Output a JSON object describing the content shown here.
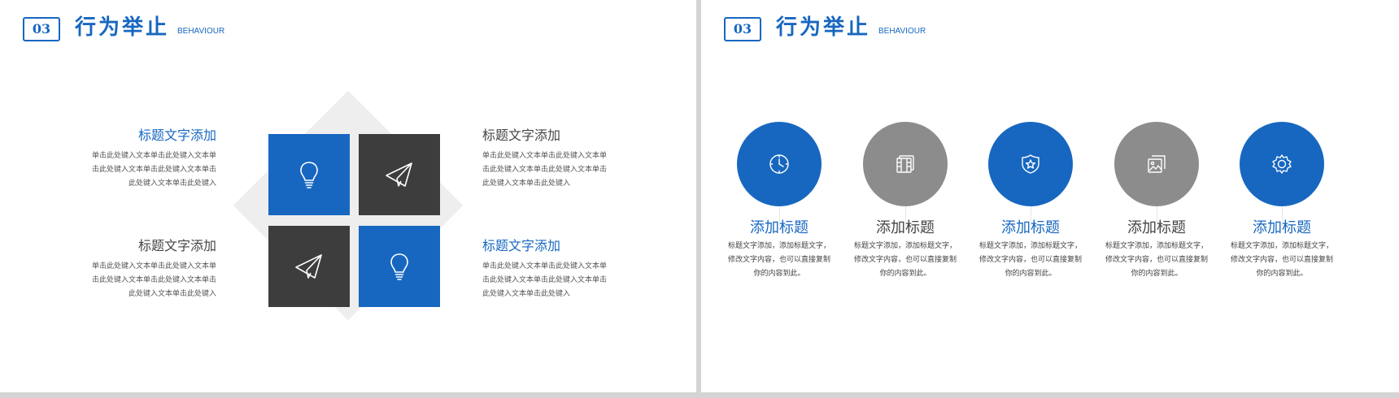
{
  "colors": {
    "accent": "#1767c0",
    "dark": "#3d3d3d",
    "gray": "#8c8c8c"
  },
  "header": {
    "number": "03",
    "title": "行为举止",
    "subtitle": "BEHAVIOUR"
  },
  "left_slide": {
    "blocks": [
      {
        "title": "标题文字添加",
        "body": [
          "单击此处键入文本单击此处键入文本单",
          "击此处键入文本单击此处键入文本单击",
          "此处键入文本单击此处键入"
        ]
      },
      {
        "title": "标题文字添加",
        "body": [
          "单击此处键入文本单击此处键入文本单",
          "击此处键入文本单击此处键入文本单击",
          "此处键入文本单击此处键入"
        ]
      },
      {
        "title": "标题文字添加",
        "body": [
          "单击此处键入文本单击此处键入文本单",
          "击此处键入文本单击此处键入文本单击",
          "此处键入文本单击此处键入"
        ]
      },
      {
        "title": "标题文字添加",
        "body": [
          "单击此处键入文本单击此处键入文本单",
          "击此处键入文本单击此处键入文本单击",
          "此处键入文本单击此处键入"
        ]
      }
    ],
    "tile_icons": [
      "lightbulb-icon",
      "paper-plane-icon",
      "paper-plane-icon",
      "lightbulb-icon"
    ]
  },
  "right_slide": {
    "features": [
      {
        "title": "添加标题",
        "icon": "clock-icon",
        "body": [
          "标题文字添加，添加标题文字，",
          "修改文字内容，也可以直接复制",
          "你的内容到此。"
        ]
      },
      {
        "title": "添加标题",
        "icon": "film-icon",
        "body": [
          "标题文字添加，添加标题文字，",
          "修改文字内容，也可以直接复制",
          "你的内容到此。"
        ]
      },
      {
        "title": "添加标题",
        "icon": "shield-star-icon",
        "body": [
          "标题文字添加，添加标题文字，",
          "修改文字内容，也可以直接复制",
          "你的内容到此。"
        ]
      },
      {
        "title": "添加标题",
        "icon": "image-gallery-icon",
        "body": [
          "标题文字添加，添加标题文字，",
          "修改文字内容，也可以直接复制",
          "你的内容到此。"
        ]
      },
      {
        "title": "添加标题",
        "icon": "gear-icon",
        "body": [
          "标题文字添加，添加标题文字，",
          "修改文字内容，也可以直接复制",
          "你的内容到此。"
        ]
      }
    ]
  }
}
